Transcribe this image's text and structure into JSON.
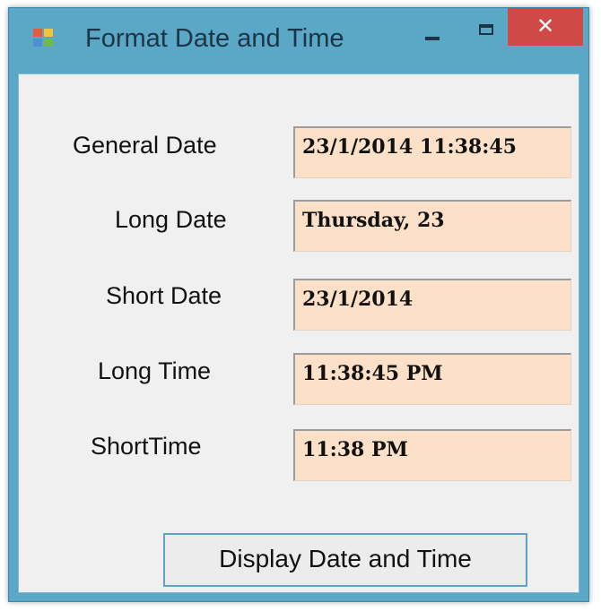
{
  "window": {
    "title": "Format Date and Time",
    "close_glyph": "✕",
    "icons": [
      "app-icon",
      "minimize-icon",
      "maximize-icon",
      "close-icon"
    ]
  },
  "form": {
    "fields": [
      {
        "label": "General Date",
        "value": "23/1/2014 11:38:45"
      },
      {
        "label": "Long Date",
        "value": "Thursday, 23"
      },
      {
        "label": "Short Date",
        "value": "23/1/2014"
      },
      {
        "label": "Long Time",
        "value": "11:38:45 PM"
      },
      {
        "label": "ShortTime",
        "value": "11:38 PM"
      }
    ],
    "button_label": "Display Date and Time"
  },
  "colors": {
    "frame": "#5aa7c6",
    "close": "#cf4a46",
    "field_bg": "#fde0c8",
    "client_bg": "#f0f0f0"
  }
}
